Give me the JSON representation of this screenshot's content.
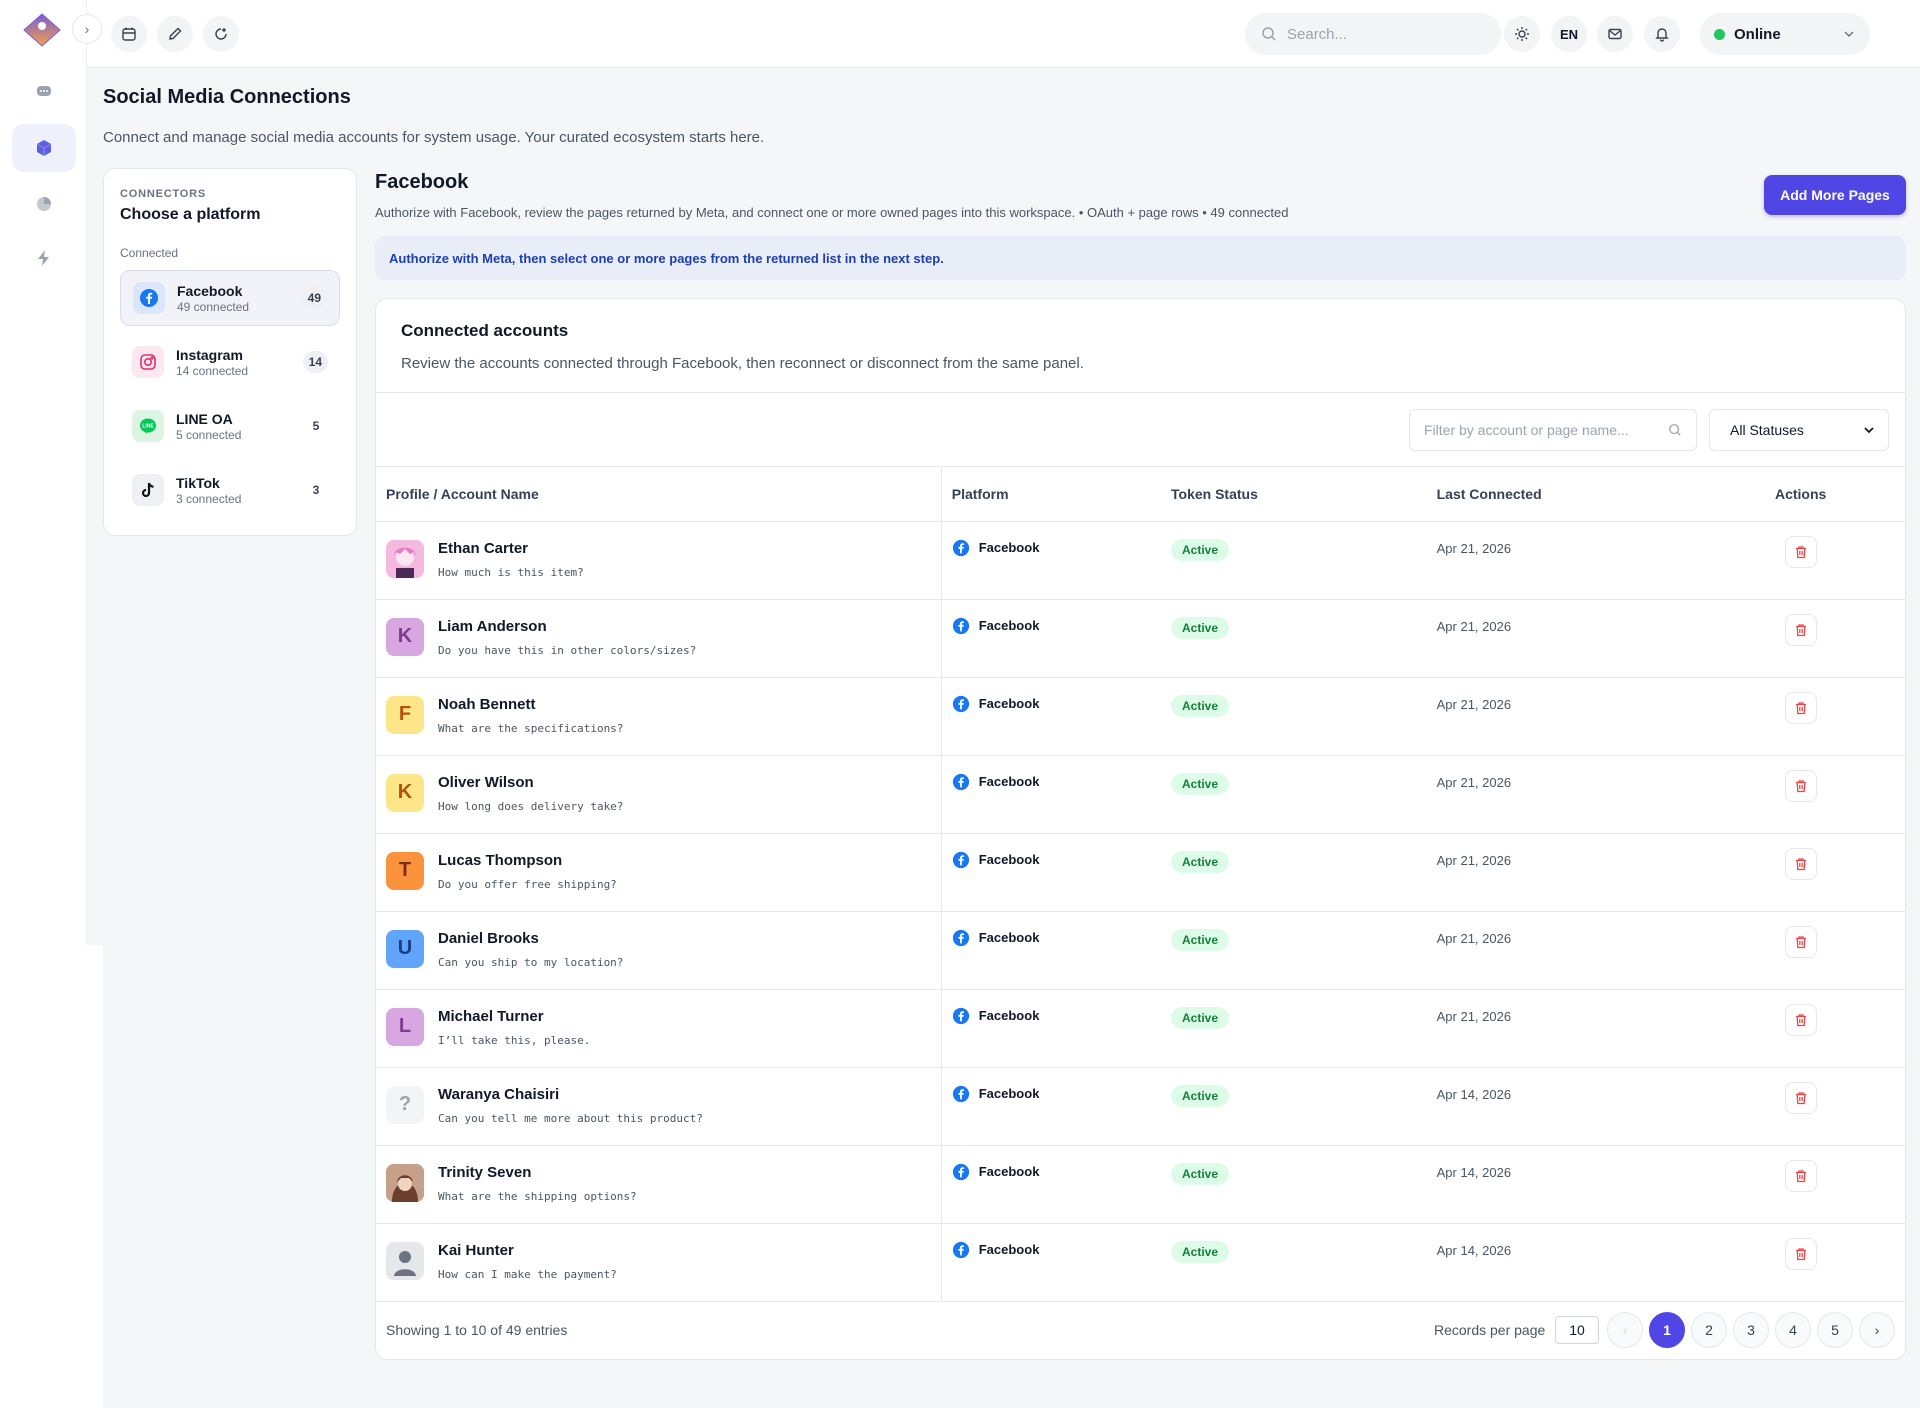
{
  "topbar": {
    "search_placeholder": "Search...",
    "language": "EN",
    "status": "Online"
  },
  "page": {
    "title": "Social Media Connections",
    "subtitle": "Connect and manage social media accounts for system usage. Your curated ecosystem starts here."
  },
  "connectors": {
    "eyebrow": "CONNECTORS",
    "title": "Choose a platform",
    "group": "Connected",
    "items": [
      {
        "name": "Facebook",
        "count_text": "49 connected",
        "badge": "49"
      },
      {
        "name": "Instagram",
        "count_text": "14 connected",
        "badge": "14"
      },
      {
        "name": "LINE OA",
        "count_text": "5 connected",
        "badge": "5"
      },
      {
        "name": "TikTok",
        "count_text": "3 connected",
        "badge": "3"
      }
    ]
  },
  "main": {
    "title": "Facebook",
    "description": "Authorize with Facebook, review the pages returned by Meta, and connect one or more owned pages into this workspace. • OAuth + page rows • 49 connected",
    "add_button": "Add More Pages",
    "banner": "Authorize with Meta, then select one or more pages from the returned list in the next step."
  },
  "panel": {
    "title": "Connected accounts",
    "description": "Review the accounts connected through Facebook, then reconnect or disconnect from the same panel.",
    "filter_placeholder": "Filter by account or page name...",
    "status_filter": "All Statuses",
    "columns": [
      "Profile / Account Name",
      "Platform",
      "Token Status",
      "Last Connected",
      "Actions"
    ]
  },
  "rows": [
    {
      "name": "Ethan Carter",
      "message": "How much is this item?",
      "platform": "Facebook",
      "status": "Active",
      "date": "Apr 21, 2026",
      "initial": "",
      "avatar_bg": "#f9c6e6",
      "avatar_fg": "#ffffff"
    },
    {
      "name": "Liam Anderson",
      "message": "Do you have this in other colors/sizes?",
      "platform": "Facebook",
      "status": "Active",
      "date": "Apr 21, 2026",
      "initial": "K",
      "avatar_bg": "#d8a6e0",
      "avatar_fg": "#7e3b8f"
    },
    {
      "name": "Noah Bennett",
      "message": "What are the specifications?",
      "platform": "Facebook",
      "status": "Active",
      "date": "Apr 21, 2026",
      "initial": "F",
      "avatar_bg": "#fde68a",
      "avatar_fg": "#b45309"
    },
    {
      "name": "Oliver Wilson",
      "message": "How long does delivery take?",
      "platform": "Facebook",
      "status": "Active",
      "date": "Apr 21, 2026",
      "initial": "K",
      "avatar_bg": "#fde68a",
      "avatar_fg": "#b45309"
    },
    {
      "name": "Lucas Thompson",
      "message": "Do you offer free shipping?",
      "platform": "Facebook",
      "status": "Active",
      "date": "Apr 21, 2026",
      "initial": "T",
      "avatar_bg": "#fb923c",
      "avatar_fg": "#7c2d12"
    },
    {
      "name": "Daniel Brooks",
      "message": "Can you ship to my location?",
      "platform": "Facebook",
      "status": "Active",
      "date": "Apr 21, 2026",
      "initial": "U",
      "avatar_bg": "#60a5fa",
      "avatar_fg": "#1e3a8a"
    },
    {
      "name": "Michael Turner",
      "message": "I’ll take this, please.",
      "platform": "Facebook",
      "status": "Active",
      "date": "Apr 21, 2026",
      "initial": "L",
      "avatar_bg": "#d8a6e0",
      "avatar_fg": "#7e3b8f"
    },
    {
      "name": "Waranya Chaisiri",
      "message": "Can you tell me more about this product?",
      "platform": "Facebook",
      "status": "Active",
      "date": "Apr 14, 2026",
      "initial": "?",
      "avatar_bg": "#f3f4f6",
      "avatar_fg": "#9ca3af"
    },
    {
      "name": "Trinity Seven",
      "message": "What are the shipping options?",
      "platform": "Facebook",
      "status": "Active",
      "date": "Apr 14, 2026",
      "initial": "",
      "avatar_bg": "#8b5e4a",
      "avatar_fg": "#ffffff"
    },
    {
      "name": "Kai Hunter",
      "message": "How can I make the payment?",
      "platform": "Facebook",
      "status": "Active",
      "date": "Apr 14, 2026",
      "initial": "",
      "avatar_bg": "#e5e7eb",
      "avatar_fg": "#6b7280"
    }
  ],
  "pagination": {
    "showing": "Showing 1 to 10 of 49 entries",
    "records_label": "Records per page",
    "records_value": "10",
    "pages": [
      "1",
      "2",
      "3",
      "4",
      "5"
    ]
  },
  "colors": {
    "accent": "#4f46e5",
    "facebook": "#1877f2",
    "success": "#15803d"
  }
}
